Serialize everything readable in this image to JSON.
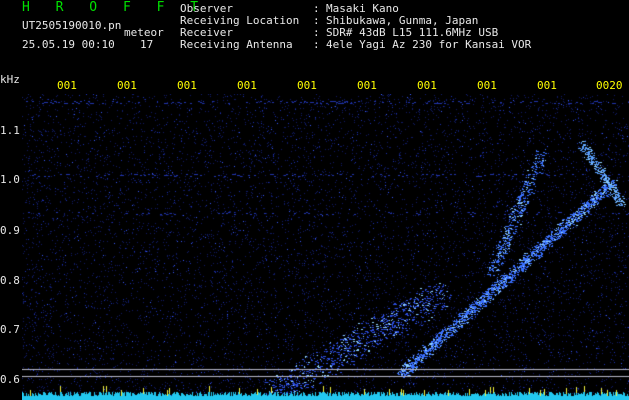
{
  "header": {
    "brand": "H R O F F T",
    "filename": "UT2505190010.pn",
    "tag": "meteor",
    "datetime": "25.05.19 00:10",
    "count": "17",
    "fields": [
      {
        "label": "Observer",
        "value": "Masaki Kano"
      },
      {
        "label": "Receiving Location",
        "value": "Shibukawa, Gunma, Japan"
      },
      {
        "label": "Receiver",
        "value": "SDR# 43dB L15 111.6MHz USB"
      },
      {
        "label": "Receiving Antenna",
        "value": "4ele Yagi Az 230 for Kansai VOR"
      }
    ],
    "separator": ":"
  },
  "time_ticks": [
    "001",
    "001",
    "001",
    "001",
    "001",
    "001",
    "001",
    "001",
    "001",
    "0020"
  ],
  "y_axis": {
    "unit": "kHz",
    "labels": [
      "1.1",
      "1.0",
      "0.9",
      "0.8",
      "0.7",
      "0.6"
    ],
    "values": [
      1.1,
      1.0,
      0.9,
      0.8,
      0.7,
      0.6
    ],
    "range": [
      0.58,
      1.14
    ]
  },
  "colors": {
    "background": "#000000",
    "header_green": "#00e000",
    "tick_yellow": "#ffff00",
    "noise": "#1a2aa8",
    "signal": "#4aa0ff",
    "bottom_band": "#22d0ff"
  }
}
